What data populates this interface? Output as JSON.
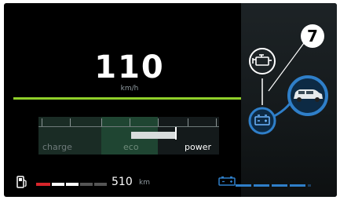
{
  "speed": {
    "value": "110",
    "unit": "km/h"
  },
  "gauge": {
    "labels": {
      "charge": "charge",
      "eco": "eco",
      "power": "power"
    },
    "active_zone": "power"
  },
  "fuel": {
    "icon": "fuel-pump-icon",
    "range": "510",
    "range_unit": "km"
  },
  "battery": {
    "icon": "battery-icon",
    "level_segments": 4
  },
  "energy_flow": {
    "icons": [
      "engine-icon",
      "car-icon",
      "battery-icon"
    ],
    "callout": "7"
  },
  "colors": {
    "accent_green": "#8fcf2a",
    "accent_blue": "#2f7fc9",
    "fuel_red": "#d8252b"
  }
}
